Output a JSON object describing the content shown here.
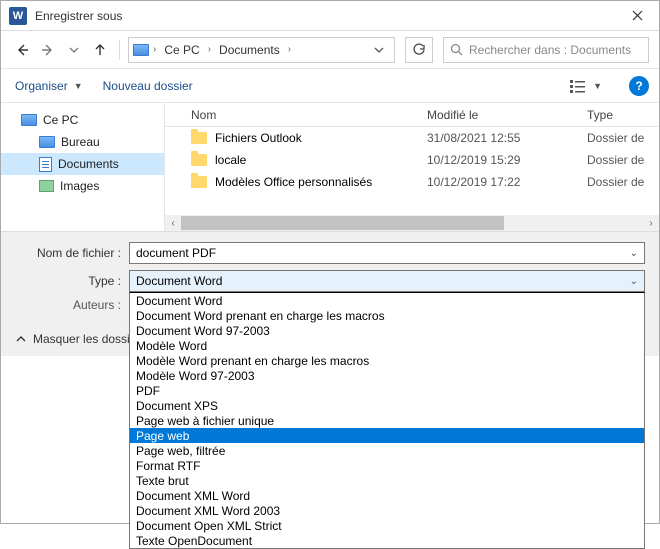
{
  "window": {
    "title": "Enregistrer sous",
    "app_letter": "W"
  },
  "nav": {
    "breadcrumb": {
      "root": "Ce PC",
      "current": "Documents"
    },
    "search_placeholder": "Rechercher dans : Documents"
  },
  "toolbar": {
    "organize": "Organiser",
    "new_folder": "Nouveau dossier"
  },
  "tree": {
    "root": "Ce PC",
    "items": [
      "Bureau",
      "Documents",
      "Images"
    ],
    "selected_index": 1
  },
  "columns": {
    "name": "Nom",
    "modified": "Modifié le",
    "type": "Type"
  },
  "files": [
    {
      "name": "Fichiers Outlook",
      "modified": "31/08/2021 12:55",
      "type": "Dossier de"
    },
    {
      "name": "locale",
      "modified": "10/12/2019 15:29",
      "type": "Dossier de"
    },
    {
      "name": "Modèles Office personnalisés",
      "modified": "10/12/2019 17:22",
      "type": "Dossier de"
    }
  ],
  "form": {
    "filename_label": "Nom de fichier :",
    "filename_value": "document PDF",
    "type_label": "Type :",
    "type_selected": "Document Word",
    "authors_label": "Auteurs :",
    "type_options": [
      "Document Word",
      "Document Word prenant en charge les macros",
      "Document Word 97-2003",
      "Modèle Word",
      "Modèle Word prenant en charge les macros",
      "Modèle Word 97-2003",
      "PDF",
      "Document XPS",
      "Page web à fichier unique",
      "Page web",
      "Page web, filtrée",
      "Format RTF",
      "Texte brut",
      "Document XML Word",
      "Document XML Word 2003",
      "Document Open XML Strict",
      "Texte OpenDocument"
    ],
    "type_highlight_index": 9
  },
  "footer": {
    "collapse": "Masquer les dossiers"
  }
}
